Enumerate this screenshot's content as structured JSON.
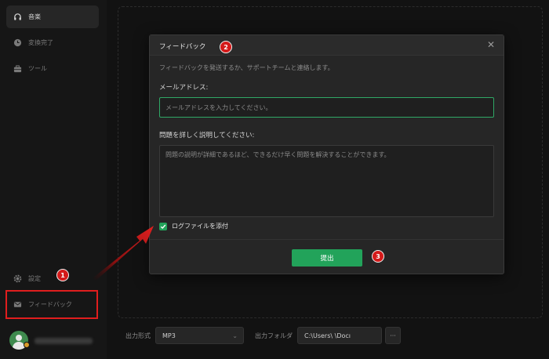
{
  "sidebar": {
    "items": [
      {
        "label": "音楽",
        "icon": "headphones-icon"
      },
      {
        "label": "変換完了",
        "icon": "clock-icon"
      },
      {
        "label": "ツール",
        "icon": "toolbox-icon"
      }
    ],
    "settings_label": "設定",
    "feedback_label": "フィードバック"
  },
  "bottom_bar": {
    "format_label": "出力形式",
    "format_value": "MP3",
    "folder_label": "出力フォルダ",
    "folder_value": "C:\\Users\\          \\Docı",
    "more_label": "···"
  },
  "modal": {
    "title": "フィードバック",
    "close_label": "✕",
    "description": "フィードバックを発送するか、サポートチームと連絡します。",
    "email_label": "メールアドレス:",
    "email_placeholder": "メールアドレスを入力してください。",
    "problem_label": "問題を詳しく説明してください:",
    "problem_placeholder": "問題の説明が詳細であるほど、できるだけ早く問題を解決することができます。",
    "attach_label": "ログファイルを添付",
    "attach_checked": true,
    "submit_label": "提出"
  },
  "annotations": [
    "1",
    "2",
    "3"
  ],
  "colors": {
    "accent": "#22a35a",
    "annotation_red": "#d41a1a",
    "highlight_border": "#e01e1e"
  }
}
